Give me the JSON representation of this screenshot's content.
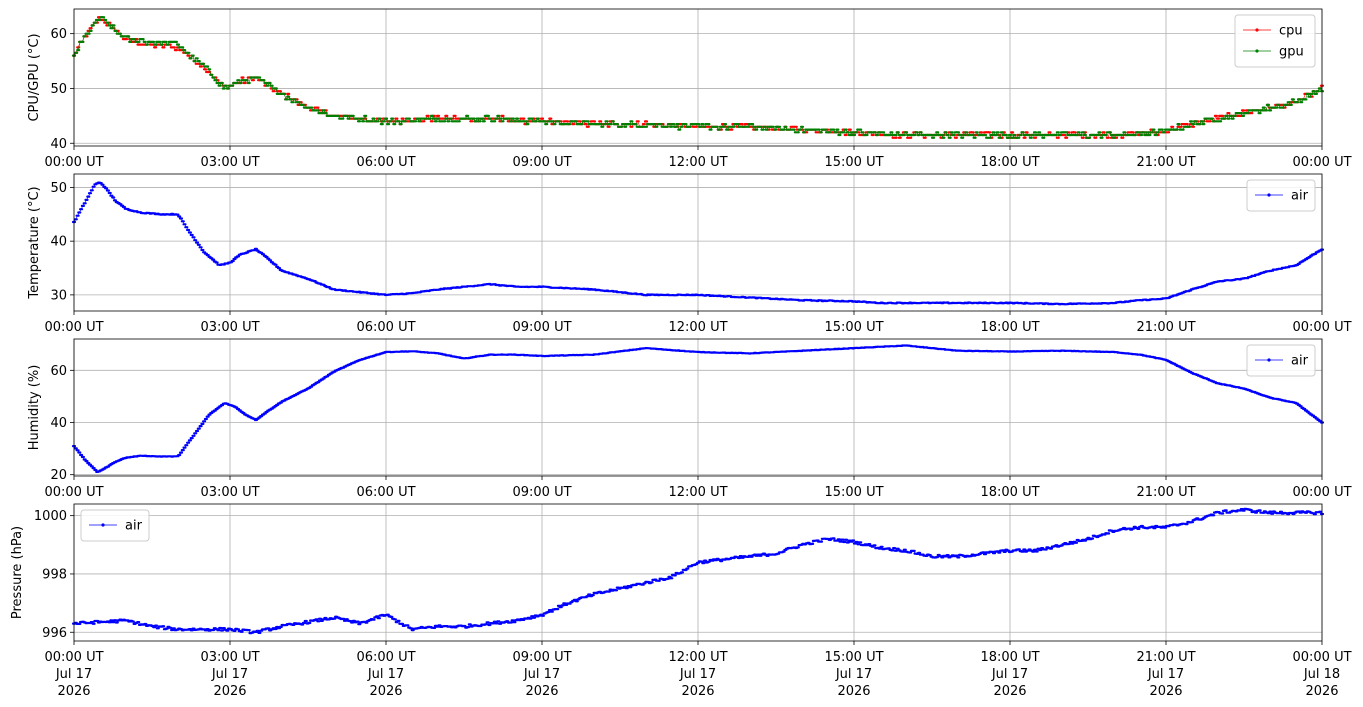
{
  "chart_data": [
    {
      "type": "line",
      "ylabel": "CPU/GPU (°C)",
      "ylim": [
        39.5,
        64.5
      ],
      "yticks": [
        40,
        50,
        60
      ],
      "x_ticks": [
        "00:00 UT",
        "03:00 UT",
        "06:00 UT",
        "09:00 UT",
        "12:00 UT",
        "15:00 UT",
        "18:00 UT",
        "21:00 UT",
        "00:00 UT"
      ],
      "grid": true,
      "legend": "upper right",
      "x": [
        0,
        0.25,
        0.5,
        0.75,
        1,
        1.5,
        2,
        2.5,
        2.9,
        3.1,
        3.5,
        4,
        4.5,
        5,
        6,
        7,
        8,
        9,
        10,
        11,
        12,
        13,
        14,
        15,
        16,
        17,
        18,
        19,
        20,
        20.9,
        21.5,
        22,
        22.5,
        23,
        23.5,
        24
      ],
      "series": [
        {
          "name": "cpu",
          "color": "#ff0000",
          "values": [
            56,
            60,
            63,
            61,
            59,
            58,
            57.5,
            54,
            50,
            51,
            52,
            49,
            46.5,
            45,
            44,
            44.5,
            44.5,
            44,
            43.5,
            43.5,
            43,
            43,
            42.5,
            42,
            41.5,
            41.5,
            41.5,
            41.5,
            41.5,
            42,
            43.5,
            44.5,
            45.5,
            46.5,
            47.5,
            50
          ]
        },
        {
          "name": "gpu",
          "color": "#008000",
          "values": [
            56,
            60,
            63,
            61,
            59,
            58.5,
            58,
            54,
            50,
            51,
            52,
            49,
            46.5,
            45,
            44,
            44.5,
            44.5,
            44,
            43.5,
            43.5,
            43,
            43,
            42.5,
            42,
            41.5,
            41.5,
            41.5,
            41.5,
            41.5,
            42,
            43.5,
            44.5,
            45.5,
            46.5,
            47.5,
            50
          ]
        }
      ]
    },
    {
      "type": "line",
      "ylabel": "Temperature (°C)",
      "ylim": [
        27,
        52.5
      ],
      "yticks": [
        30,
        40,
        50
      ],
      "x_ticks": [
        "00:00 UT",
        "03:00 UT",
        "06:00 UT",
        "09:00 UT",
        "12:00 UT",
        "15:00 UT",
        "18:00 UT",
        "21:00 UT",
        "00:00 UT"
      ],
      "grid": true,
      "legend": "upper right",
      "x": [
        0,
        0.2,
        0.4,
        0.5,
        0.6,
        0.8,
        1,
        1.3,
        1.7,
        2,
        2.2,
        2.5,
        2.8,
        3,
        3.2,
        3.5,
        3.7,
        4,
        4.5,
        5,
        5.5,
        6,
        6.5,
        7,
        7.5,
        8,
        8.5,
        9,
        10,
        11,
        12,
        13,
        14,
        15,
        15.5,
        16,
        17,
        18,
        19,
        20,
        20.5,
        21,
        21.5,
        22,
        22.5,
        23,
        23.5,
        24
      ],
      "series": [
        {
          "name": "air",
          "color": "#0000ff",
          "values": [
            43.5,
            47,
            50.5,
            51,
            50,
            47.5,
            46,
            45.3,
            45,
            45,
            42,
            38,
            35.5,
            36,
            37.5,
            38.5,
            37,
            34.5,
            33,
            31,
            30.5,
            30,
            30.3,
            31,
            31.5,
            32,
            31.5,
            31.5,
            31,
            30,
            30,
            29.5,
            29,
            28.8,
            28.5,
            28.5,
            28.5,
            28.5,
            28.3,
            28.5,
            29,
            29.3,
            31,
            32.5,
            33,
            34.5,
            35.5,
            38.5
          ]
        }
      ]
    },
    {
      "type": "line",
      "ylabel": "Humidity (%)",
      "ylim": [
        19.5,
        72
      ],
      "yticks": [
        20,
        40,
        60
      ],
      "x_ticks": [
        "00:00 UT",
        "03:00 UT",
        "06:00 UT",
        "09:00 UT",
        "12:00 UT",
        "15:00 UT",
        "18:00 UT",
        "21:00 UT",
        "00:00 UT"
      ],
      "grid": true,
      "legend": "upper right",
      "x": [
        0,
        0.2,
        0.45,
        0.6,
        0.8,
        1,
        1.3,
        1.6,
        2,
        2.3,
        2.6,
        2.9,
        3.1,
        3.3,
        3.5,
        3.7,
        4,
        4.5,
        5,
        5.5,
        6,
        6.5,
        7,
        7.5,
        8,
        8.5,
        9,
        10,
        11,
        12,
        13,
        14,
        15,
        15.5,
        16,
        17,
        18,
        19,
        20,
        20.5,
        21,
        21.5,
        22,
        22.5,
        23,
        23.5,
        24
      ],
      "series": [
        {
          "name": "air",
          "color": "#0000ff",
          "values": [
            31,
            26,
            21,
            22.5,
            25,
            26.5,
            27.3,
            27,
            27,
            35,
            43,
            47.5,
            46,
            43,
            41,
            44,
            48,
            53,
            59.5,
            64,
            67,
            67.3,
            66.5,
            64.5,
            66,
            66,
            65.5,
            66,
            68.5,
            67,
            66.5,
            67.5,
            68.5,
            69,
            69.5,
            67.5,
            67.2,
            67.5,
            67,
            66,
            64,
            59,
            55,
            53,
            49.5,
            47.5,
            40
          ]
        }
      ]
    },
    {
      "type": "line",
      "ylabel": "Pressure (hPa)",
      "ylim": [
        995.7,
        1000.4
      ],
      "yticks": [
        996,
        998,
        1000
      ],
      "x_ticks": [
        "00:00 UT",
        "03:00 UT",
        "06:00 UT",
        "09:00 UT",
        "12:00 UT",
        "15:00 UT",
        "18:00 UT",
        "21:00 UT",
        "00:00 UT"
      ],
      "x_ticks_date": [
        "Jul 17",
        "Jul 17",
        "Jul 17",
        "Jul 17",
        "Jul 17",
        "Jul 17",
        "Jul 17",
        "Jul 17",
        "Jul 18"
      ],
      "x_ticks_year": [
        "2026",
        "2026",
        "2026",
        "2026",
        "2026",
        "2026",
        "2026",
        "2026",
        "2026"
      ],
      "grid": true,
      "legend": "upper left",
      "x": [
        0,
        1,
        1.5,
        2,
        2.5,
        3,
        3.5,
        4,
        5,
        5.5,
        6,
        6.5,
        7,
        7.5,
        8,
        8.5,
        9,
        9.5,
        10,
        11,
        11.5,
        12,
        12.5,
        13,
        13.5,
        14,
        14.5,
        15,
        15.5,
        16,
        16.5,
        17,
        17.5,
        18,
        18.5,
        19,
        19.5,
        20,
        20.5,
        21,
        21.5,
        22,
        22.5,
        23,
        23.5,
        24
      ],
      "series": [
        {
          "name": "air",
          "color": "#0000ff",
          "values": [
            996.3,
            996.4,
            996.2,
            996.1,
            996.1,
            996.1,
            996,
            996.2,
            996.5,
            996.3,
            996.6,
            996.1,
            996.2,
            996.2,
            996.3,
            996.4,
            996.6,
            997,
            997.3,
            997.7,
            997.9,
            998.4,
            998.5,
            998.6,
            998.7,
            999,
            999.2,
            999.1,
            998.9,
            998.8,
            998.6,
            998.6,
            998.7,
            998.8,
            998.8,
            999,
            999.2,
            999.5,
            999.6,
            999.6,
            999.8,
            1000.1,
            1000.2,
            1000.1,
            1000.1,
            1000.1
          ]
        }
      ]
    }
  ]
}
